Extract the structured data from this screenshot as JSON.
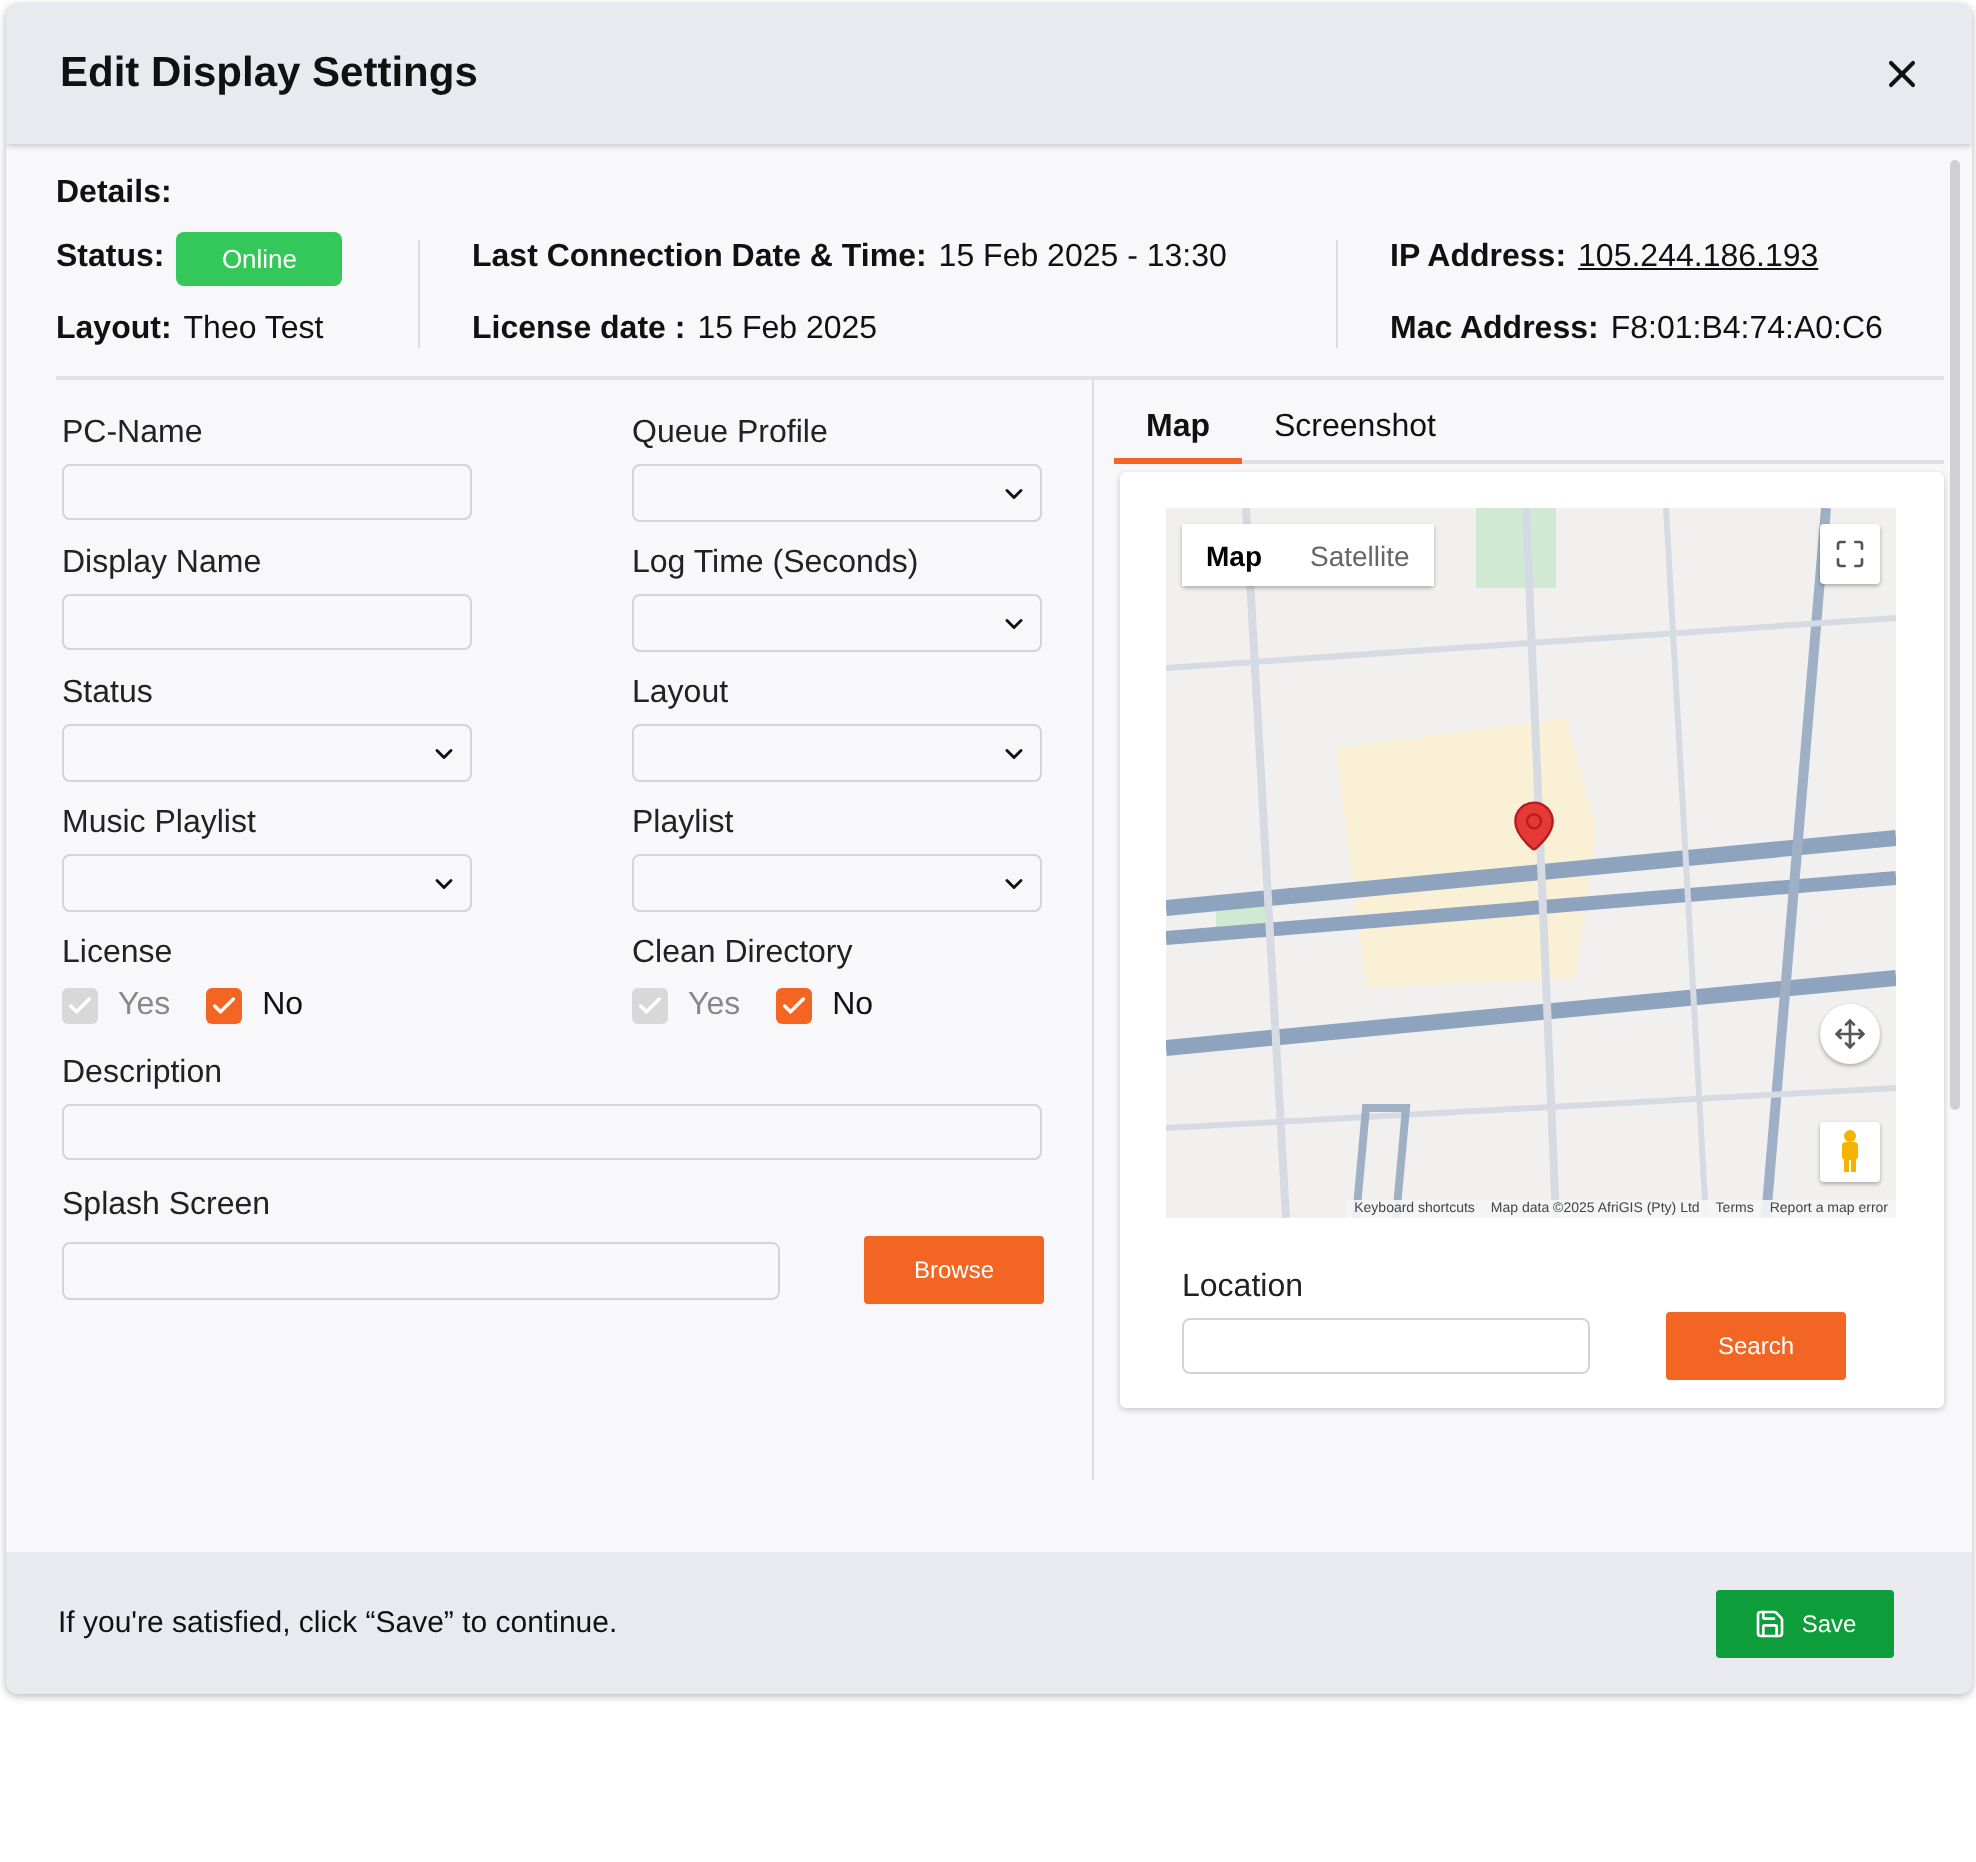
{
  "dialog": {
    "title": "Edit Display Settings"
  },
  "details": {
    "heading": "Details:",
    "status": {
      "label": "Status:",
      "value": "Online"
    },
    "layout": {
      "label": "Layout:",
      "value": "Theo Test"
    },
    "last_connection": {
      "label": "Last Connection Date & Time:",
      "value": "15 Feb 2025 - 13:30"
    },
    "license_date": {
      "label": "License date :",
      "value": "15 Feb 2025"
    },
    "ip": {
      "label": "IP Address:",
      "value": "105.244.186.193"
    },
    "mac": {
      "label": "Mac Address:",
      "value": "F8:01:B4:74:A0:C6"
    }
  },
  "fields": [
    {
      "label": "PC-Name",
      "kind": "text"
    },
    {
      "label": "Queue Profile",
      "kind": "select"
    },
    {
      "label": "Display Name",
      "kind": "text"
    },
    {
      "label": "Log Time (Seconds)",
      "kind": "select"
    },
    {
      "label": "Status",
      "kind": "select"
    },
    {
      "label": "Layout",
      "kind": "select"
    },
    {
      "label": "Music Playlist",
      "kind": "select"
    },
    {
      "label": "Playlist",
      "kind": "select"
    },
    {
      "label": "License",
      "kind": "checks",
      "options": [
        {
          "label": "Yes",
          "checked": true,
          "disabled": true
        },
        {
          "label": "No",
          "checked": true,
          "disabled": false
        }
      ]
    },
    {
      "label": "Clean Directory",
      "kind": "checks",
      "options": [
        {
          "label": "Yes",
          "checked": true,
          "disabled": true
        },
        {
          "label": "No",
          "checked": true,
          "disabled": false
        }
      ]
    }
  ],
  "description": {
    "label": "Description"
  },
  "splash": {
    "label": "Splash Screen",
    "button": "Browse"
  },
  "tabs": [
    {
      "label": "Map",
      "selected": true
    },
    {
      "label": "Screenshot",
      "selected": false
    }
  ],
  "map": {
    "types": [
      {
        "label": "Map",
        "selected": true
      },
      {
        "label": "Satellite",
        "selected": false
      }
    ],
    "attribution": [
      "Keyboard shortcuts",
      "Map data ©2025 AfriGIS (Pty) Ltd",
      "Terms",
      "Report a map error"
    ]
  },
  "location": {
    "label": "Location",
    "button": "Search"
  },
  "footer": {
    "message": "If you're satisfied, click “Save” to continue.",
    "button": "Save"
  }
}
